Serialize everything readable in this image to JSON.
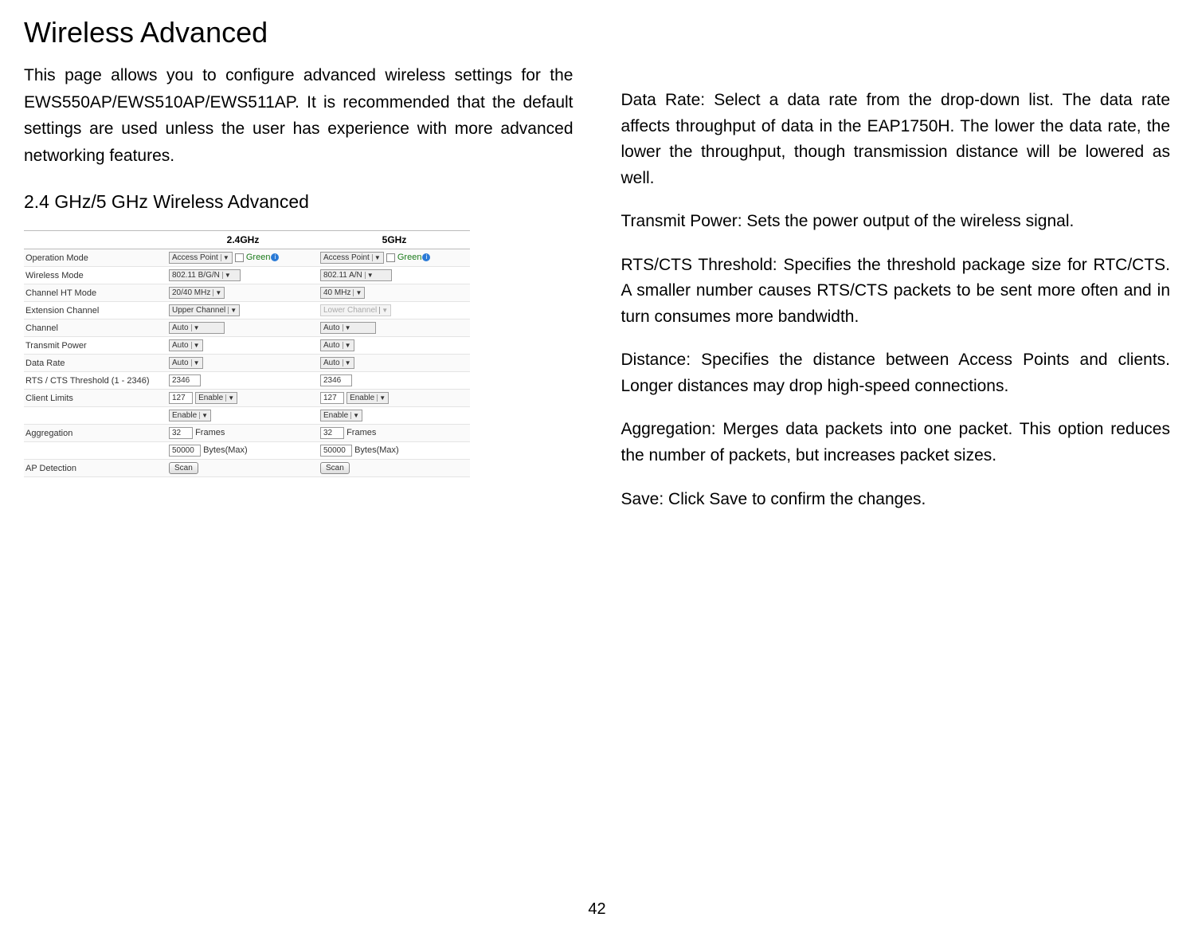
{
  "left": {
    "title": "Wireless Advanced",
    "intro": "This page allows you to configure advanced wireless settings for the EWS550AP/EWS510AP/EWS511AP. It is recommended that the default settings are used unless the user has experience with more advanced networking features.",
    "subhead": "2.4 GHz/5 GHz Wireless Advanced"
  },
  "table": {
    "col24": "2.4GHz",
    "col5": "5GHz",
    "rows": {
      "op_mode": {
        "label": "Operation Mode",
        "v24_sel": "Access Point",
        "v24_green": "Green",
        "v5_sel": "Access Point",
        "v5_green": "Green"
      },
      "wmode": {
        "label": "Wireless Mode",
        "v24": "802.11 B/G/N",
        "v5": "802.11 A/N"
      },
      "htmode": {
        "label": "Channel HT Mode",
        "v24": "20/40 MHz",
        "v5": "40 MHz"
      },
      "extch": {
        "label": "Extension Channel",
        "v24": "Upper Channel",
        "v5": "Lower Channel"
      },
      "channel": {
        "label": "Channel",
        "v24": "Auto",
        "v5": "Auto"
      },
      "txpower": {
        "label": "Transmit Power",
        "v24": "Auto",
        "v5": "Auto"
      },
      "datarate": {
        "label": "Data Rate",
        "v24": "Auto",
        "v5": "Auto"
      },
      "rtscts": {
        "label": "RTS / CTS Threshold (1 - 2346)",
        "v24": "2346",
        "v5": "2346"
      },
      "climits": {
        "label": "Client Limits",
        "v24_txt": "127",
        "v24_sel": "Enable",
        "v5_txt": "127",
        "v5_sel": "Enable"
      },
      "climits2": {
        "v24": "Enable",
        "v5": "Enable"
      },
      "agg": {
        "label": "Aggregation",
        "v24_txt": "32",
        "v24_unit": "Frames",
        "v5_txt": "32",
        "v5_unit": "Frames"
      },
      "agg2": {
        "v24_txt": "50000",
        "v24_unit": "Bytes(Max)",
        "v5_txt": "50000",
        "v5_unit": "Bytes(Max)"
      },
      "apdet": {
        "label": "AP Detection",
        "btn": "Scan"
      }
    }
  },
  "right": {
    "p1": "Data Rate: Select a data rate from the drop-down list. The data rate affects throughput of data in the EAP1750H. The lower the data rate, the lower the throughput, though transmission distance will be lowered as well.",
    "p2": "Transmit Power: Sets the power output of the wireless signal.",
    "p3": "RTS/CTS Threshold: Specifies the threshold package size for RTC/CTS. A smaller number causes RTS/CTS packets to be sent more often and in turn consumes more bandwidth.",
    "p4": "Distance: Specifies the distance between Access Points and clients. Longer distances may drop high-speed connections.",
    "p5": "Aggregation: Merges data packets into one packet. This option reduces the number of packets, but increases packet sizes.",
    "p6": "Save: Click Save to confirm the changes."
  },
  "pagenum": "42"
}
